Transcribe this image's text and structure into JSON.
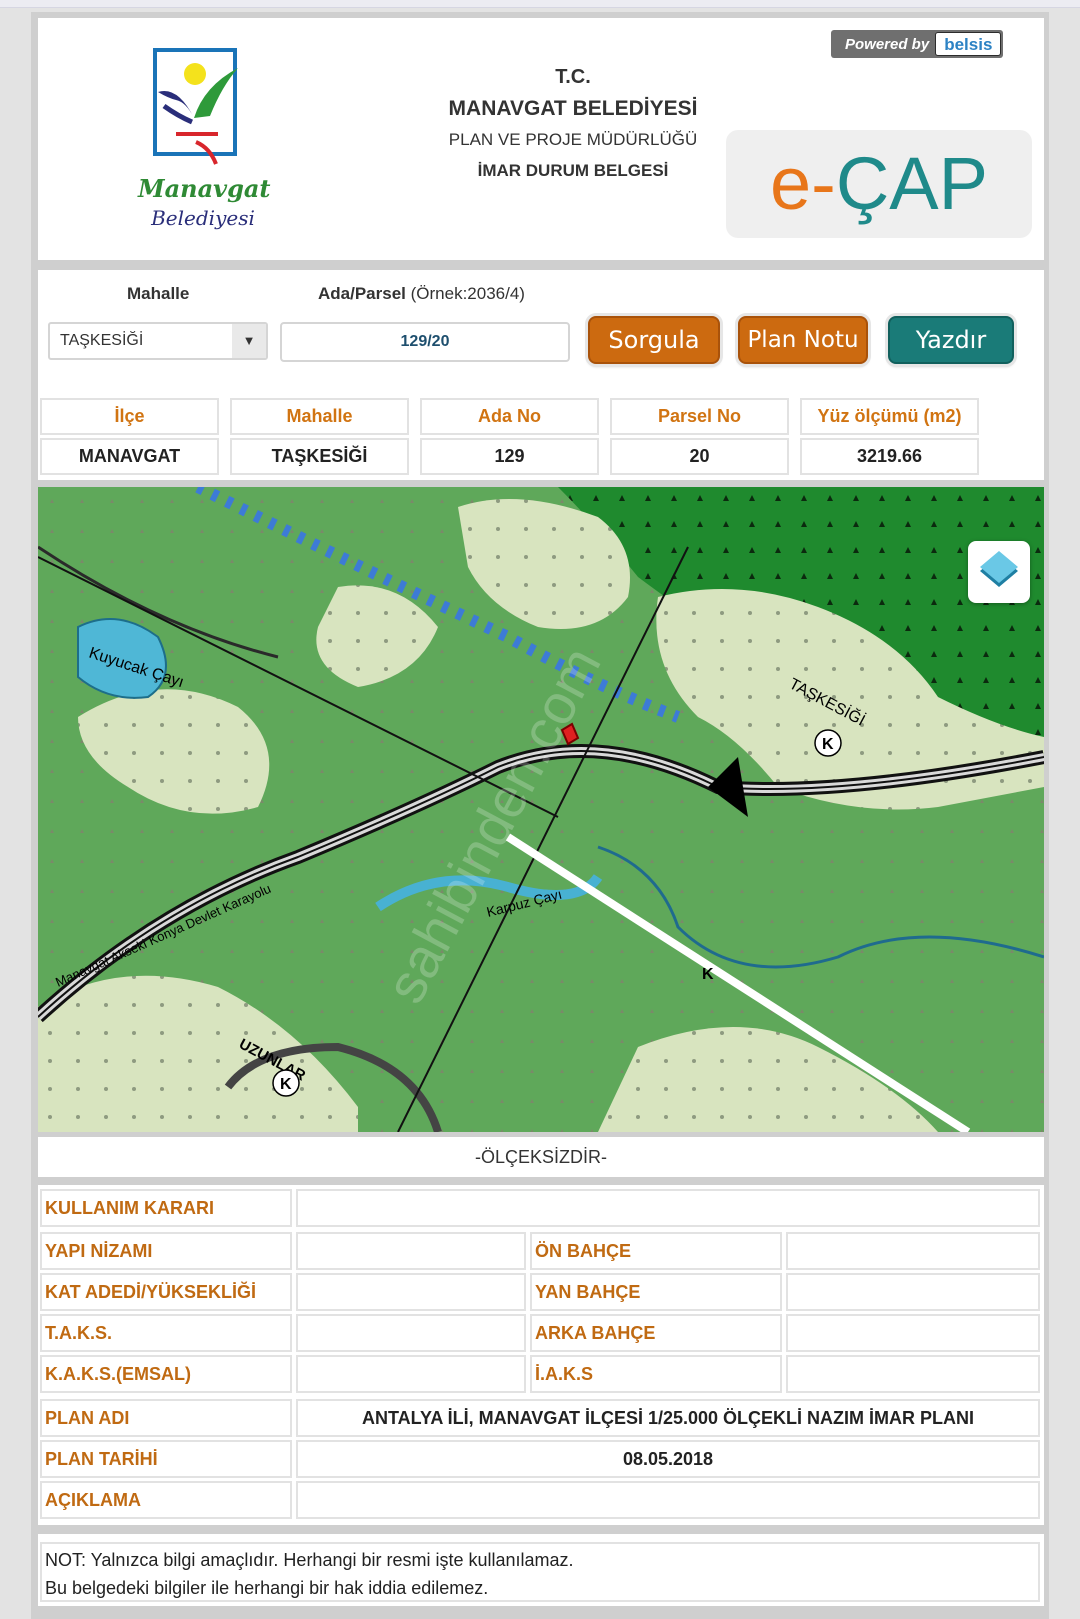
{
  "header": {
    "logo_word": "Manavgat",
    "logo_sub": "Belediyesi",
    "line1": "T.C.",
    "line2": "MANAVGAT BELEDİYESİ",
    "line3": "PLAN VE PROJE MÜDÜRLÜĞÜ",
    "line4": "İMAR DURUM BELGESİ",
    "powered_by": "Powered by",
    "powered_brand": "belsis",
    "ecap_e": "e-",
    "ecap_rest": "ÇAP"
  },
  "query": {
    "mahalle_label": "Mahalle",
    "ada_label": "Ada/Parsel",
    "ada_example": "(Örnek:2036/4)",
    "mahalle_selected": "TAŞKESİĞİ",
    "parcel_value": "129/20",
    "buttons": {
      "sorgula": "Sorgula",
      "plan_notu": "Plan Notu",
      "yazdir": "Yazdır"
    }
  },
  "info_table": {
    "headers": [
      "İlçe",
      "Mahalle",
      "Ada No",
      "Parsel No",
      "Yüz ölçümü (m2)"
    ],
    "values": [
      "MANAVGAT",
      "TAŞKESİĞİ",
      "129",
      "20",
      "3219.66"
    ]
  },
  "map": {
    "labels": [
      "Kuyucak Çayı",
      "TAŞKESİĞİ",
      "Manavgat Akseki Konya Devlet Karayolu",
      "Karpuz Çayı",
      "UZUNLAR",
      "K",
      "K",
      "K"
    ],
    "watermark": "sahibinden.com"
  },
  "scale_note": "-ÖLÇEKSİZDİR-",
  "details": {
    "kullanim_karari": {
      "label": "KULLANIM KARARI",
      "value": ""
    },
    "yapi_nizami": {
      "label": "YAPI NİZAMI",
      "value": ""
    },
    "on_bahce": {
      "label": "ÖN BAHÇE",
      "value": ""
    },
    "kat_adedi": {
      "label": "KAT ADEDİ/YÜKSEKLİĞİ",
      "value": ""
    },
    "yan_bahce": {
      "label": "YAN BAHÇE",
      "value": ""
    },
    "taks": {
      "label": "T.A.K.S.",
      "value": ""
    },
    "arka_bahce": {
      "label": "ARKA BAHÇE",
      "value": ""
    },
    "kaks": {
      "label": "K.A.K.S.(EMSAL)",
      "value": ""
    },
    "iaks": {
      "label": "İ.A.K.S",
      "value": ""
    },
    "plan_adi": {
      "label": "PLAN ADI",
      "value": "ANTALYA İLİ, MANAVGAT İLÇESİ 1/25.000 ÖLÇEKLİ NAZIM İMAR PLANI"
    },
    "plan_tarihi": {
      "label": "PLAN TARİHİ",
      "value": "08.05.2018"
    },
    "aciklama": {
      "label": "AÇIKLAMA",
      "value": ""
    }
  },
  "note": {
    "line1": "NOT: Yalnızca bilgi amaçlıdır. Herhangi bir resmi işte kullanılamaz.",
    "line2": "Bu belgedeki bilgiler ile herhangi bir hak iddia edilemez."
  }
}
